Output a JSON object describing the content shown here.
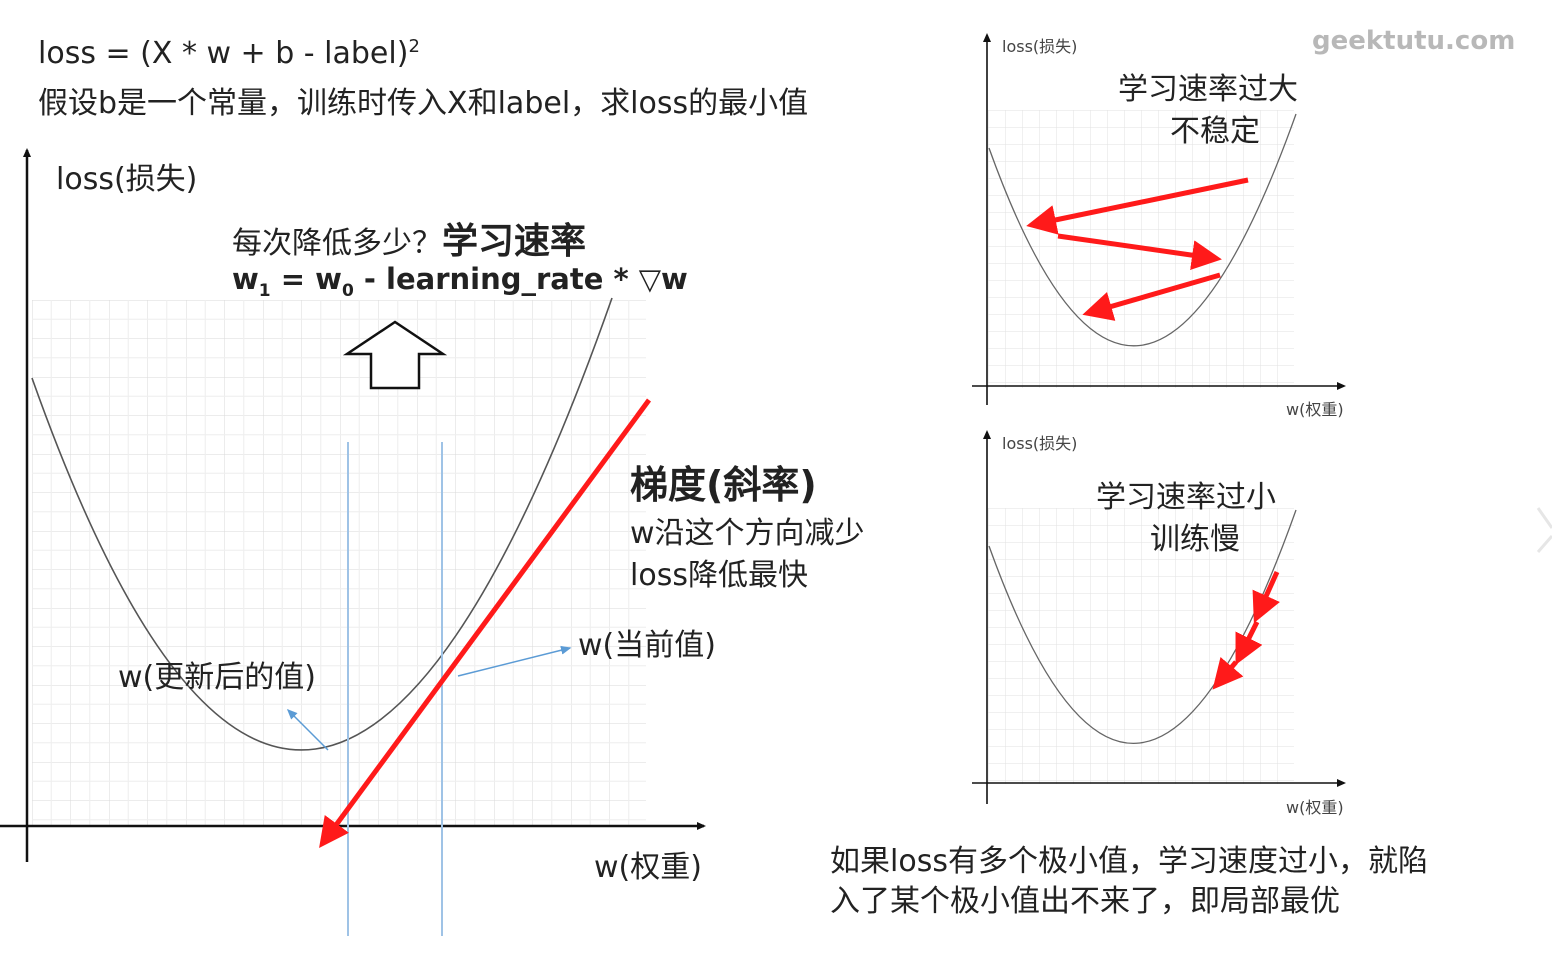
{
  "formula": {
    "line1": "loss = (X * w + b - label)",
    "line1_sup": "2",
    "line2": "假设b是一个常量，训练时传入X和label，求loss的最小值"
  },
  "main_plot": {
    "y_label": "loss(损失)",
    "x_label": "w(权重)",
    "question": "每次降低多少？",
    "question_bold": "学习速率",
    "update_rule": {
      "w1": "w",
      "w1_sub": "1",
      "eq": " = ",
      "w0": "w",
      "w0_sub": "0",
      "rest": " - learning_rate * ▽w"
    },
    "gradient_title": "梯度(斜率)",
    "gradient_desc1": "w沿这个方向减少",
    "gradient_desc2": "loss降低最快",
    "current_label": "w(当前值)",
    "updated_label": "w(更新后的值)",
    "colors": {
      "tangent": "#ff1a1a",
      "guide": "#9fc3e6",
      "curve": "#555555",
      "grid": "#d9d9d9"
    }
  },
  "plot_large_lr": {
    "y_label": "loss(损失)",
    "x_label": "w(权重)",
    "title1": "学习速率过大",
    "title2": "不稳定"
  },
  "plot_small_lr": {
    "y_label": "loss(损失)",
    "x_label": "w(权重)",
    "title1": "学习速率过小",
    "title2": "训练慢"
  },
  "watermark": "geektutu.com",
  "note": {
    "line1": "如果loss有多个极小值，学习速度过小，就陷",
    "line2": "入了某个极小值出不来了，即局部最优"
  }
}
